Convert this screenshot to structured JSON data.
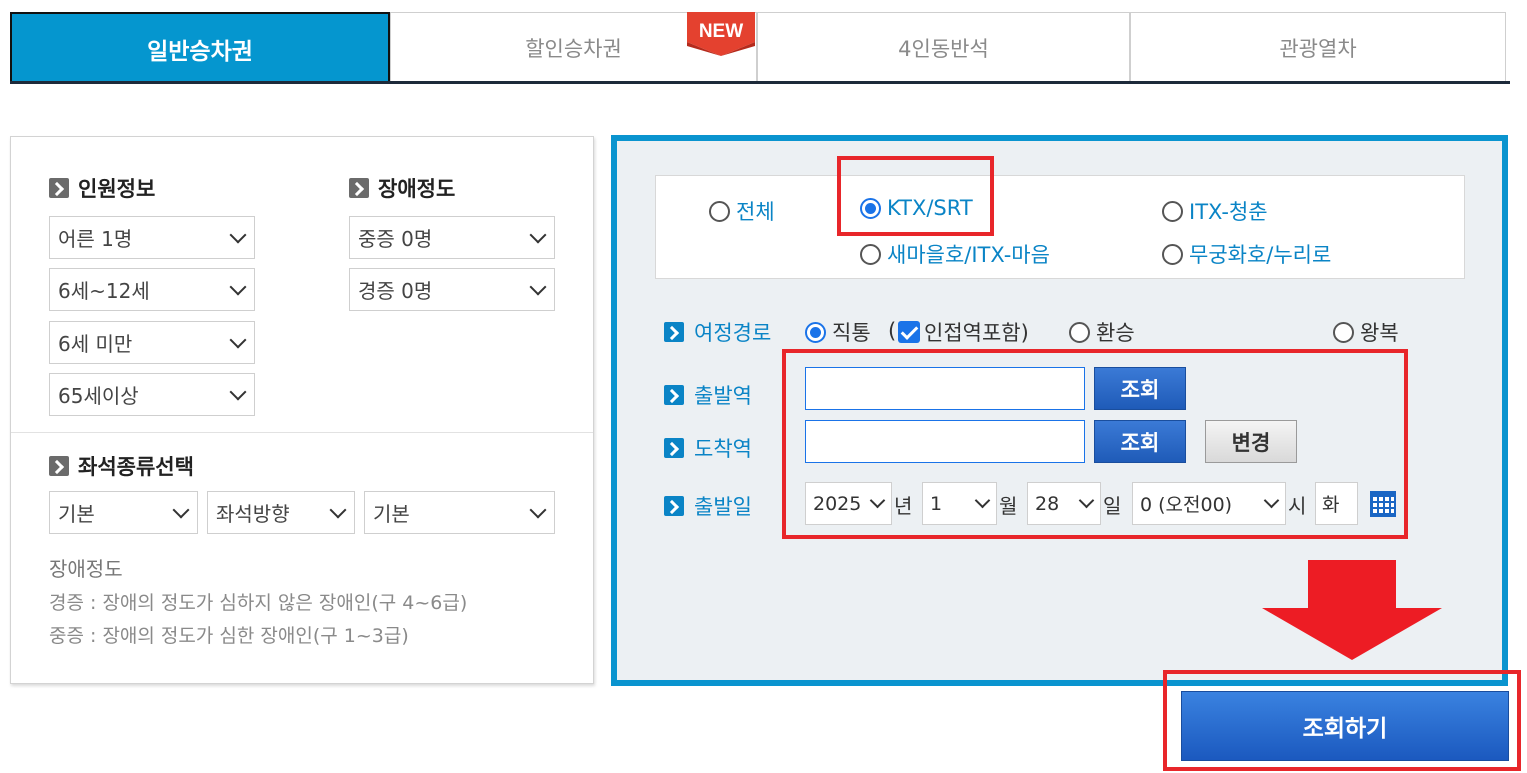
{
  "tabs": [
    {
      "label": "일반승차권",
      "active": true
    },
    {
      "label": "할인승차권",
      "active": false
    },
    {
      "label": "4인동반석",
      "active": false
    },
    {
      "label": "관광열차",
      "active": false
    }
  ],
  "new_badge": "NEW",
  "left": {
    "passenger_title": "인원정보",
    "passenger_selects": [
      "어른 1명",
      "6세~12세",
      "6세 미만",
      "65세이상"
    ],
    "disability_title": "장애정도",
    "disability_selects": [
      "중증 0명",
      "경증 0명"
    ],
    "seat_title": "좌석종류선택",
    "seat_selects": [
      "기본",
      "좌석방향",
      "기본"
    ],
    "note_title": "장애정도",
    "note_lines": [
      "경증 : 장애의 정도가 심하지 않은 장애인(구 4~6급)",
      "중증 : 장애의 정도가 심한 장애인(구 1~3급)"
    ]
  },
  "right": {
    "train_types": {
      "all": "전체",
      "ktx": "KTX/SRT",
      "itx_youth": "ITX-청춘",
      "saemaeul": "새마을호/ITX-마음",
      "mugunghwa": "무궁화호/누리로"
    },
    "route_label": "여정경로",
    "route_direct": "직통",
    "route_paren_open": "(",
    "route_nearby": "인접역포함)",
    "route_transfer": "환승",
    "route_round": "왕복",
    "departure_label": "출발역",
    "arrival_label": "도착역",
    "date_label": "출발일",
    "lookup_btn": "조회",
    "change_btn": "변경",
    "date": {
      "year": "2025",
      "year_unit": "년",
      "month": "1",
      "month_unit": "월",
      "day": "28",
      "day_unit": "일",
      "hour": "0 (오전00)",
      "hour_unit": "시",
      "weekday": "화"
    }
  },
  "search_button": "조회하기",
  "colors": {
    "tab_active": "#0596cf",
    "panel_border": "#0a94cf",
    "highlight": "#e8262a",
    "button_blue": "#1f5bb8"
  }
}
